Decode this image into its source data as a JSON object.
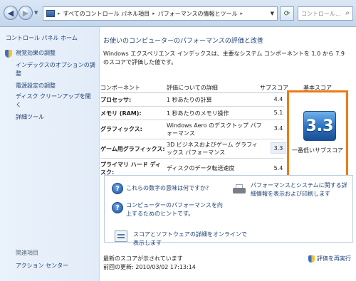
{
  "address": {
    "crumbs": [
      "すべてのコントロール パネル項目",
      "パフォーマンスの情報とツール"
    ],
    "search_placeholder": "コントロール..."
  },
  "sidebar": {
    "home": "コントロール パネル ホーム",
    "items": [
      {
        "label": "視覚効果の調整"
      },
      {
        "label": "インデックスのオプションの調整"
      },
      {
        "label": "電源設定の調整"
      },
      {
        "label": "ディスク クリーンアップを開く"
      },
      {
        "label": "詳細ツール"
      }
    ],
    "see_also": "関連項目",
    "action_center": "アクション センター"
  },
  "main": {
    "title": "お使いのコンピューターのパフォーマンスの評価と改善",
    "description": "Windows エクスペリエンス インデックスは、主要なシステム コンポーネントを 1.0 から 7.9 のスコアで評価した値です。",
    "columns": {
      "component": "コンポーネント",
      "details": "評価についての詳細",
      "subscore": "サブスコア",
      "basescore": "基本スコア"
    },
    "rows": [
      {
        "component": "プロセッサ:",
        "detail": "1 秒あたりの計算",
        "score": "4.4"
      },
      {
        "component": "メモリ (RAM):",
        "detail": "1 秒あたりのメモリ操作",
        "score": "5.1"
      },
      {
        "component": "グラフィックス:",
        "detail": "Windows Aero のデスクトップ パフォーマンス",
        "score": "3.4"
      },
      {
        "component": "ゲーム用グラフィックス:",
        "detail": "3D ビジネスおよびゲーム グラフィックス パフォーマンス",
        "score": "3.3"
      },
      {
        "component": "プライマリ ハード ディスク:",
        "detail": "ディスクのデータ転送速度",
        "score": "5.4"
      }
    ],
    "base_score": "3.3",
    "base_caption": "一番低いサブスコア",
    "links": {
      "what_mean": "これらの数字の意味は何ですか?",
      "tips": "コンピューターのパフォーマンスを向上するためのヒントです。",
      "print": "パフォーマンスとシステムに関する詳細情報を表示および印刷します",
      "software": "スコアとソフトウェアの詳細をオンラインで表示します"
    },
    "status": "最新のスコアが示されています",
    "last_update": "前回の更新: 2010/03/02 17:13:14",
    "rerun": "評価を再実行"
  },
  "colors": {
    "highlight_border": "#ee7a14",
    "link": "#1e3f73",
    "badge_blue": "#2a6fc0"
  }
}
